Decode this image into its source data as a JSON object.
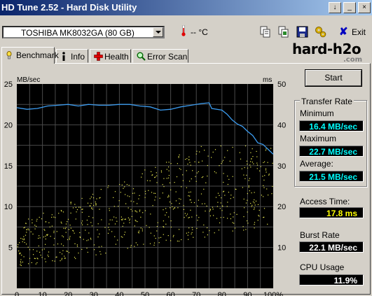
{
  "window": {
    "title": "HD Tune 2.52 - Hard Disk Utility",
    "controls": [
      "↓",
      "_",
      "×"
    ]
  },
  "toolbar": {
    "drive": "TOSHIBA MK8032GA (80 GB)",
    "temperature": "-- °C",
    "icons": [
      "copy-text-icon",
      "copy-screenshot-icon",
      "save-icon",
      "options-icon"
    ],
    "exit_label": "Exit"
  },
  "tabs": [
    {
      "label": "Benchmark",
      "icon": "benchmark-icon",
      "active": true
    },
    {
      "label": "Info",
      "icon": "info-icon",
      "active": false
    },
    {
      "label": "Health",
      "icon": "health-icon",
      "active": false
    },
    {
      "label": "Error Scan",
      "icon": "error-scan-icon",
      "active": false
    }
  ],
  "logo": {
    "main": "hard-h2o",
    "sub": ".com"
  },
  "start_label": "Start",
  "transfer_rate": {
    "title": "Transfer Rate",
    "minimum_label": "Minimum",
    "minimum": "16.4 MB/sec",
    "maximum_label": "Maximum",
    "maximum": "22.7 MB/sec",
    "average_label": "Average:",
    "average": "21.5 MB/sec"
  },
  "access_time": {
    "label": "Access Time:",
    "value": "17.8 ms"
  },
  "burst_rate": {
    "label": "Burst Rate",
    "value": "22.1 MB/sec"
  },
  "cpu_usage": {
    "label": "CPU Usage",
    "value": "11.9%"
  },
  "colors": {
    "transfer_line": "#3c9cf0",
    "access_dots": "#e8e850",
    "plot_bg": "#000000",
    "grid": "#4a4a4a",
    "accent_text": "#00ffff"
  },
  "chart_data": {
    "type": "line",
    "y_left_label": "MB/sec",
    "y_right_label": "ms",
    "ylim_left": [
      0,
      25
    ],
    "ylim_right": [
      0,
      50
    ],
    "x_ticks": [
      "0",
      "10",
      "20",
      "30",
      "40",
      "50",
      "60",
      "70",
      "80",
      "90",
      "100%"
    ],
    "y_left_ticks": [
      "5",
      "10",
      "15",
      "20",
      "25"
    ],
    "y_right_ticks": [
      "10",
      "20",
      "30",
      "40",
      "50"
    ],
    "grid": true,
    "series": [
      {
        "kind": "transfer_rate",
        "x": [
          0,
          4,
          8,
          12,
          16,
          20,
          24,
          28,
          32,
          36,
          40,
          44,
          48,
          52,
          56,
          60,
          64,
          68,
          72,
          75,
          76,
          80,
          82,
          84,
          86,
          88,
          90,
          92,
          94,
          96,
          98,
          100
        ],
        "y": [
          22.1,
          21.9,
          22.0,
          22.3,
          22.4,
          22.5,
          22.3,
          22.5,
          22.4,
          22.4,
          22.5,
          22.5,
          22.3,
          22.2,
          21.8,
          21.9,
          22.2,
          22.4,
          22.6,
          22.7,
          22.0,
          21.8,
          21.3,
          20.6,
          20.1,
          19.8,
          19.2,
          18.7,
          17.8,
          17.6,
          17.0,
          16.4
        ]
      },
      {
        "kind": "access_time_ms",
        "x_range": [
          0,
          100
        ],
        "ms_low_start": 5,
        "ms_high_start": 16,
        "ms_low_end": 18,
        "ms_high_end": 35,
        "count": 650
      }
    ]
  }
}
